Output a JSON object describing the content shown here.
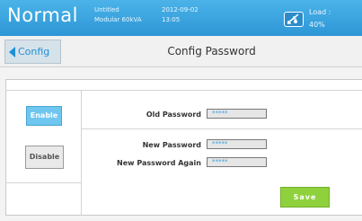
{
  "status_bar": {
    "mode": "Normal",
    "info_line1": "Untitled",
    "info_line2": "Modular 60kVA",
    "date": "2012-09-02",
    "time": "13:05",
    "load_label": "Load :",
    "load_value": "40%"
  },
  "header": {
    "back_label": "Config",
    "title": "Config Password"
  },
  "toggle": {
    "enable_label": "Enable",
    "disable_label": "Disable"
  },
  "fields": {
    "old_password_label": "Old Password",
    "old_password_value": "*****",
    "new_password_label": "New Password",
    "new_password_value": "*****",
    "new_password_again_label": "New Password Again",
    "new_password_again_value": "*****"
  },
  "actions": {
    "save_label": "Save"
  },
  "colors": {
    "topbar": "#2d96d6",
    "accent": "#1e90d6",
    "enable": "#6fc6ef",
    "save": "#8fd13d"
  }
}
